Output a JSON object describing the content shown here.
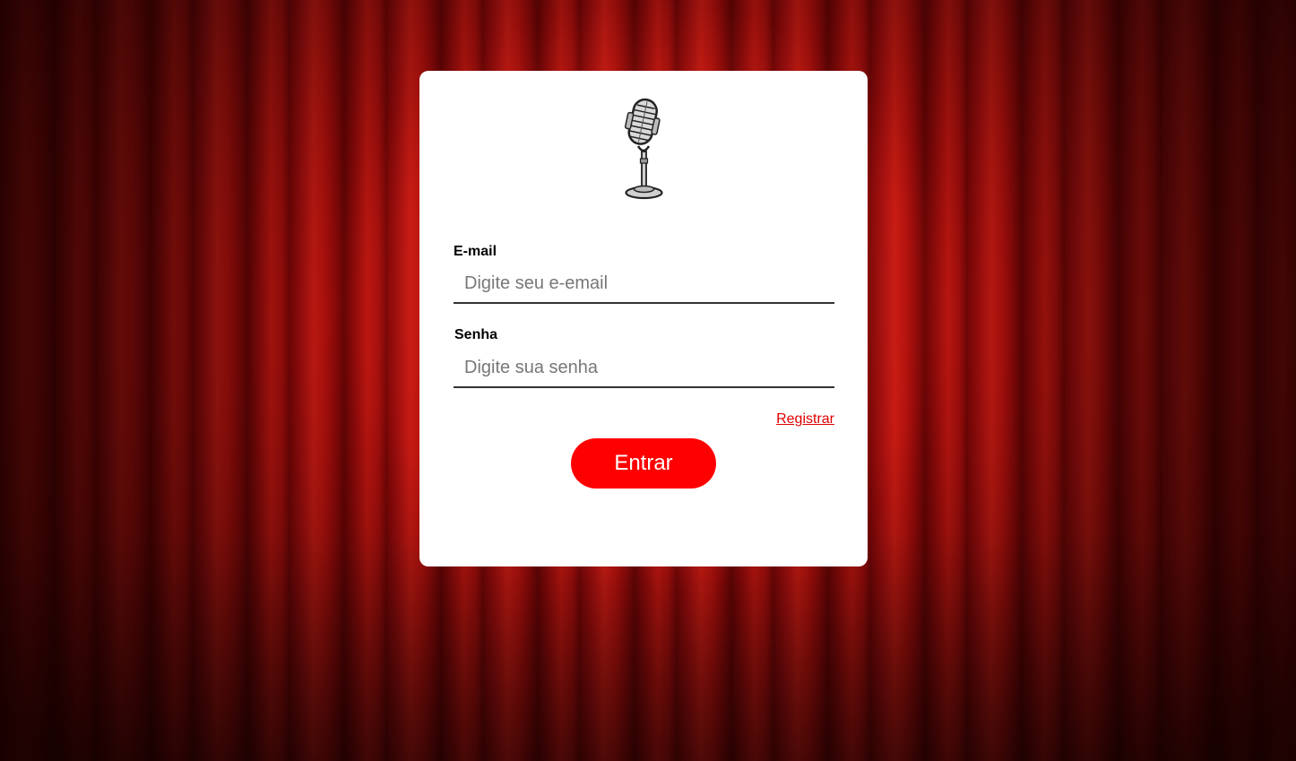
{
  "background": {
    "icon": "theater-curtain",
    "color": "#b3120e"
  },
  "logo": {
    "icon": "vintage-microphone-icon"
  },
  "form": {
    "email": {
      "label": "E-mail",
      "placeholder": "Digite seu e-email",
      "value": ""
    },
    "password": {
      "label": "Senha",
      "placeholder": "Digite sua senha",
      "value": ""
    },
    "register_link": "Registrar",
    "submit_label": "Entrar"
  },
  "colors": {
    "accent": "#ff0000",
    "link": "#e00000",
    "card": "#ffffff"
  }
}
